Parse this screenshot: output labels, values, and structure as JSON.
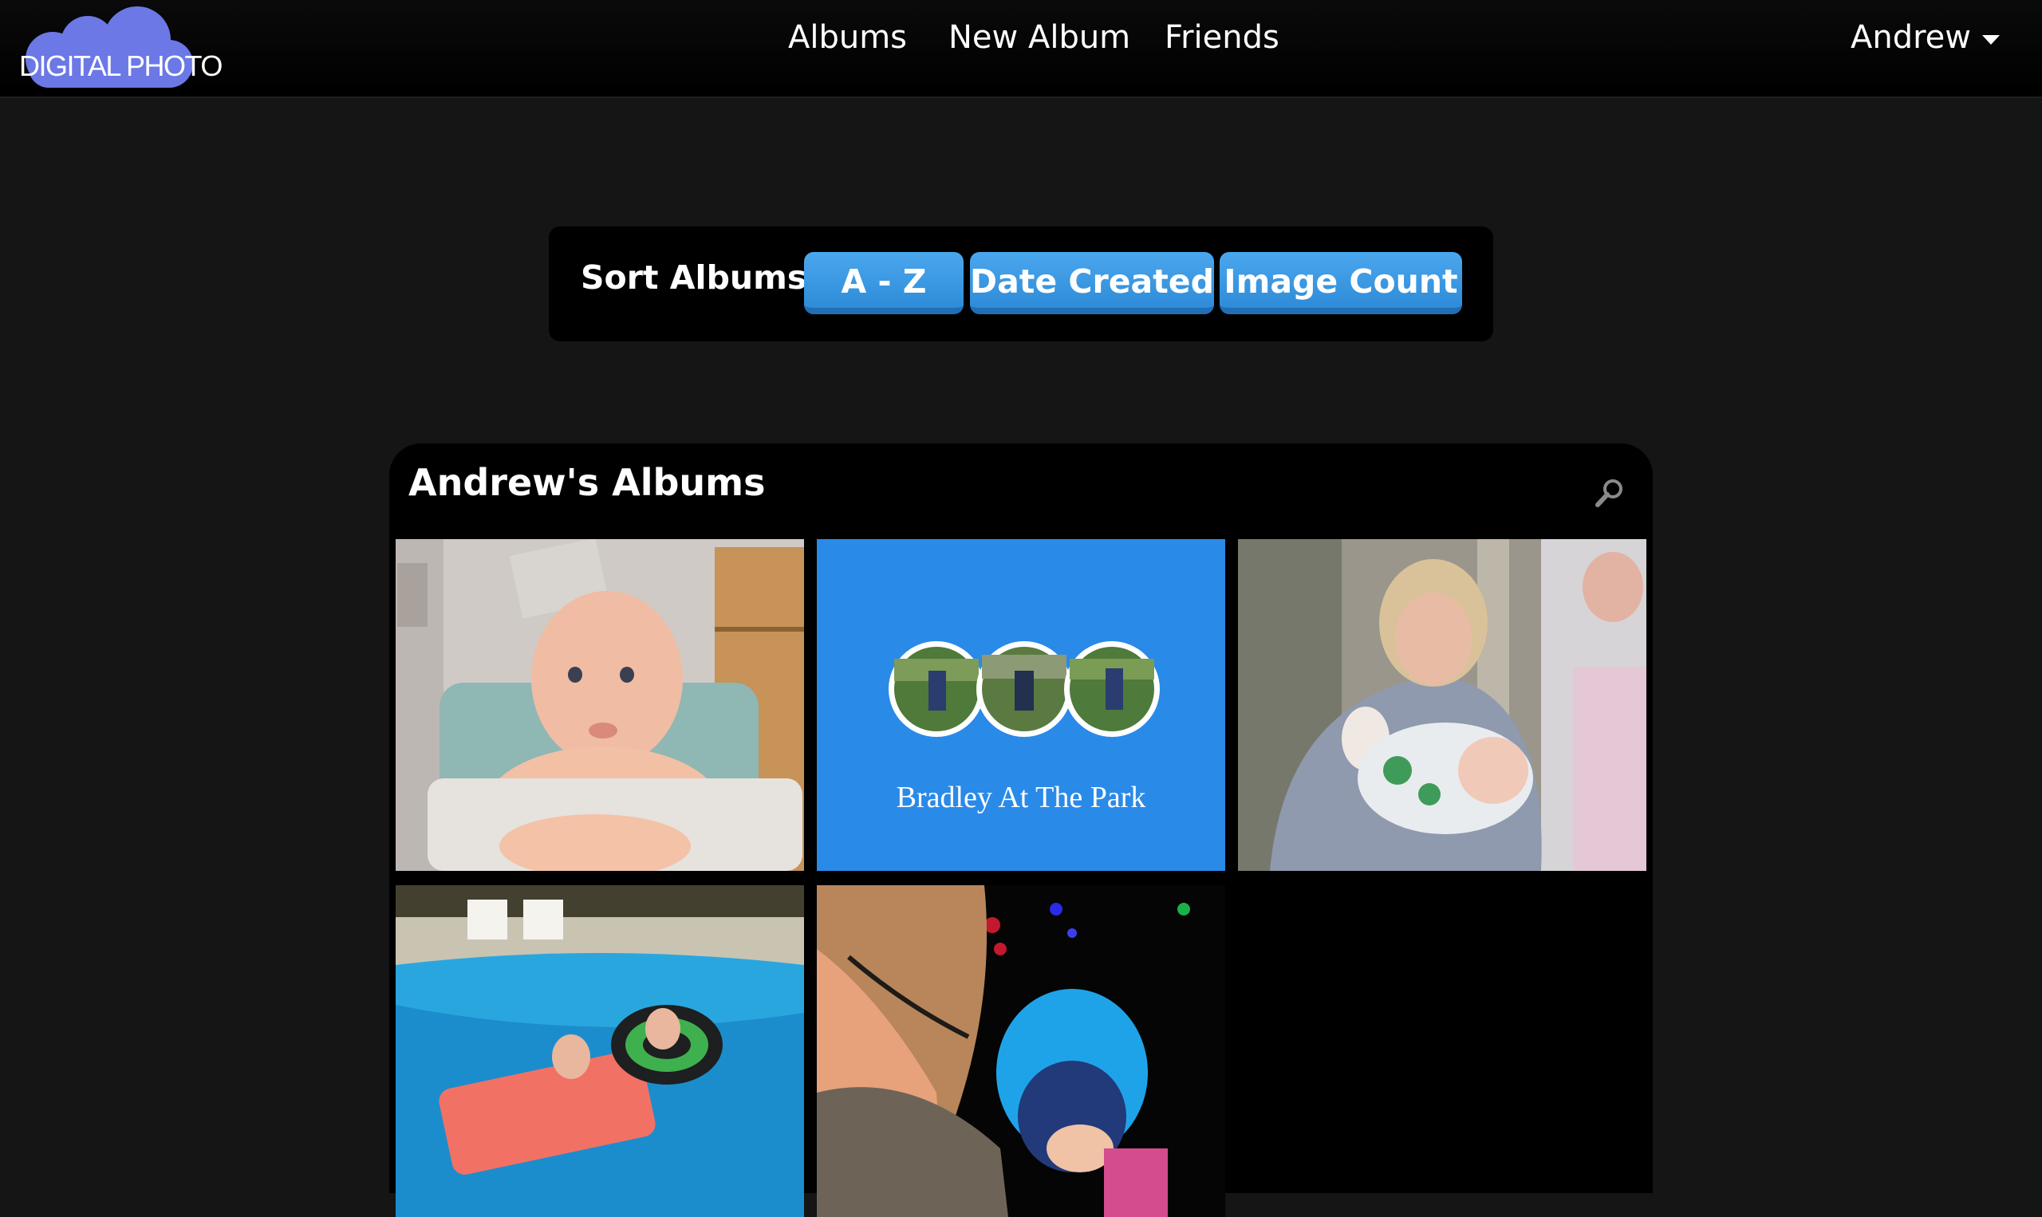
{
  "logo": {
    "text": "DIGITAL PHOTO",
    "color": "#6b78e6"
  },
  "nav": {
    "albums": "Albums",
    "new_album": "New Album",
    "friends": "Friends"
  },
  "user": {
    "name": "Andrew"
  },
  "sort": {
    "label": "Sort Albums",
    "buttons": [
      "A - Z",
      "Date Created",
      "Image Count"
    ],
    "button_color": "#3b9be6"
  },
  "albums": {
    "title": "Andrew's Albums",
    "items": [
      {
        "kind": "photo",
        "subject": "baby in high chair"
      },
      {
        "kind": "cover",
        "title": "Bradley At The Park"
      },
      {
        "kind": "photo",
        "subject": "grandmother holding newborn"
      },
      {
        "kind": "photo",
        "subject": "pool floats"
      },
      {
        "kind": "photo",
        "subject": "child in blue hood at night"
      }
    ]
  }
}
